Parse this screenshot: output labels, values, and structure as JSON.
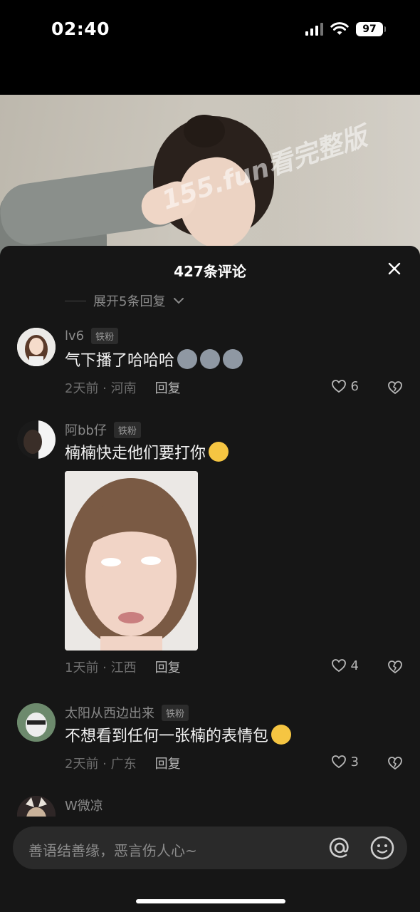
{
  "status_bar": {
    "time": "02:40",
    "battery": "97",
    "icons": [
      "signal-icon",
      "wifi-icon",
      "battery-icon"
    ]
  },
  "video": {
    "watermark": "155.fun看完整版"
  },
  "comments_panel": {
    "title": "427条评论",
    "close_icon": "close-icon",
    "expand_text": "展开5条回复"
  },
  "comments": [
    {
      "username": "lv6",
      "badge": "铁粉",
      "text": "气下播了哈哈哈",
      "emojis": [
        "wolf-emoji",
        "wolf-emoji",
        "wolf-emoji"
      ],
      "time_location": "2天前 · 河南",
      "reply": "回复",
      "likes": "6"
    },
    {
      "username": "阿bb仔",
      "badge": "铁粉",
      "text": "楠楠快走他们要打你",
      "emojis": [
        "crying-emoji"
      ],
      "time_location": "1天前 · 江西",
      "reply": "回复",
      "likes": "4",
      "has_image": true
    },
    {
      "username": "太阳从西边出来",
      "badge": "铁粉",
      "text": "不想看到任何一张楠的表情包",
      "emojis": [
        "grin-sweat-emoji"
      ],
      "time_location": "2天前 · 广东",
      "reply": "回复",
      "likes": "3"
    },
    {
      "username": "W微凉"
    }
  ],
  "input": {
    "placeholder": "善语结善缘，恶言伤人心~"
  },
  "colors": {
    "sheet_bg": "#161616",
    "muted_text": "#8a8a8a",
    "input_bg": "#2a2a2a"
  }
}
